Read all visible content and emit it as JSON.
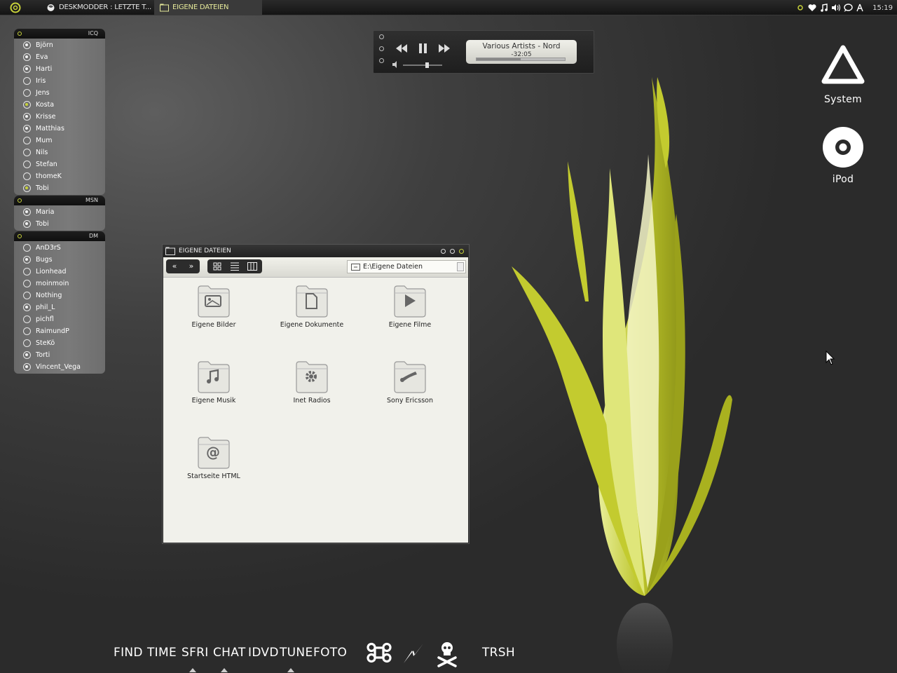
{
  "taskbar": {
    "tasks": [
      {
        "label": "DESKMODDER : LETZTE T..."
      },
      {
        "label": "EIGENE DATEIEN"
      }
    ],
    "tray_icons": [
      "status-dot-icon",
      "heart-icon",
      "music-note-icon",
      "volume-icon",
      "chat-bubble-icon",
      "antenna-icon"
    ],
    "clock": "15:19"
  },
  "buddy_lists": [
    {
      "name": "ICQ",
      "buddies": [
        {
          "name": "Björn",
          "status": "online"
        },
        {
          "name": "Eva",
          "status": "online"
        },
        {
          "name": "Harti",
          "status": "online"
        },
        {
          "name": "Iris",
          "status": "offline"
        },
        {
          "name": "Jens",
          "status": "offline"
        },
        {
          "name": "Kosta",
          "status": "away"
        },
        {
          "name": "Krisse",
          "status": "online"
        },
        {
          "name": "Matthias",
          "status": "online"
        },
        {
          "name": "Mum",
          "status": "offline"
        },
        {
          "name": "Nils",
          "status": "offline"
        },
        {
          "name": "Stefan",
          "status": "offline"
        },
        {
          "name": "thomeK",
          "status": "offline"
        },
        {
          "name": "Tobi",
          "status": "away"
        }
      ]
    },
    {
      "name": "MSN",
      "buddies": [
        {
          "name": "Maria",
          "status": "online"
        },
        {
          "name": "Tobi",
          "status": "online"
        }
      ]
    },
    {
      "name": "DM",
      "buddies": [
        {
          "name": "AnD3rS",
          "status": "offline"
        },
        {
          "name": "Bugs",
          "status": "online"
        },
        {
          "name": "Lionhead",
          "status": "offline"
        },
        {
          "name": "moinmoin",
          "status": "offline"
        },
        {
          "name": "Nothing",
          "status": "offline"
        },
        {
          "name": "phil_L",
          "status": "online"
        },
        {
          "name": "pichfl",
          "status": "offline"
        },
        {
          "name": "RaimundP",
          "status": "offline"
        },
        {
          "name": "SteKö",
          "status": "offline"
        },
        {
          "name": "Torti",
          "status": "online"
        },
        {
          "name": "Vincent_Vega",
          "status": "online"
        }
      ]
    }
  ],
  "player": {
    "track": "Various Artists - Nord",
    "time": "-32:05",
    "volume_fraction": 0.6,
    "progress_fraction": 0.5
  },
  "desktop_icons": [
    {
      "label": "System",
      "icon": "triangle-system-icon"
    },
    {
      "label": "iPod",
      "icon": "ipod-wheel-icon"
    }
  ],
  "window": {
    "title": "EIGENE DATEIEN",
    "nav_buttons": [
      "«",
      "»"
    ],
    "address": "E:\\Eigene Dateien",
    "items": [
      {
        "label": "Eigene Bilder",
        "icon": "pictures-folder-icon"
      },
      {
        "label": "Eigene Dokumente",
        "icon": "documents-folder-icon"
      },
      {
        "label": "Eigene Filme",
        "icon": "videos-folder-icon"
      },
      {
        "label": "Eigene Musik",
        "icon": "music-folder-icon"
      },
      {
        "label": "Inet Radios",
        "icon": "settings-folder-icon"
      },
      {
        "label": "Sony Ericsson",
        "icon": "tools-folder-icon"
      },
      {
        "label": "Startseite HTML",
        "icon": "web-folder-icon"
      }
    ]
  },
  "dock": {
    "items": [
      "FIND",
      "TIME",
      "SFRI",
      "CHAT",
      "IDVD",
      "TUNE",
      "FOTO",
      "TRSH"
    ],
    "symbols": [
      "command-icon",
      "lightning-icon",
      "skull-crossbones-icon"
    ],
    "running": [
      "SFRI",
      "CHAT",
      "TUNE"
    ]
  },
  "colors": {
    "accent": "#c8d23a",
    "plant": "#b9c12a",
    "window_bg": "#f1f1eb",
    "taskbar": "#1a1a1a"
  }
}
